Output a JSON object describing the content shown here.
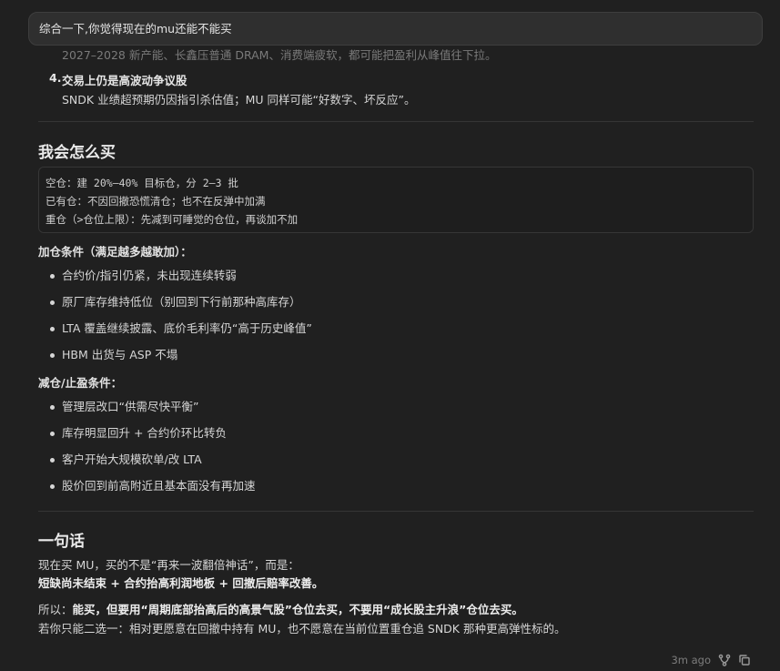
{
  "prompt": {
    "text": "综合一下,你觉得现在的mu还能不能买"
  },
  "faded_line": "2027–2028 新产能、长鑫压普通 DRAM、消费端疲软，都可能把盈利从峰值往下拉。",
  "item4": {
    "num": "4.",
    "heading": "交易上仍是高波动争议股",
    "body": "SNDK 业绩超预期仍因指引杀估值；MU 同样可能“好数字、坏反应”。"
  },
  "section_buy": {
    "title": "我会怎么买",
    "code_lines": [
      "空仓：建 20%–40% 目标仓，分 2–3 批",
      "已有仓：不因回撤恐慌清仓；也不在反弹中加满",
      "重仓（>仓位上限）：先减到可睡觉的仓位，再谈加不加"
    ],
    "add_label": "加仓条件（满足越多越敢加）：",
    "add_items": [
      "合约价/指引仍紧，未出现连续转弱",
      "原厂库存维持低位（别回到下行前那种高库存）",
      "LTA 覆盖继续披露、底价毛利率仍“高于历史峰值”",
      "HBM 出货与 ASP 不塌"
    ],
    "reduce_label": "减仓/止盈条件：",
    "reduce_items": [
      "管理层改口“供需尽快平衡”",
      "库存明显回升 + 合约价环比转负",
      "客户开始大规模砍单/改 LTA",
      "股价回到前高附近且基本面没有再加速"
    ]
  },
  "section_summary": {
    "title": "一句话",
    "line1": "现在买 MU，买的不是“再来一波翻倍神话”，而是：",
    "line2": "短缺尚未结束 + 合约抬高利润地板 + 回撤后赔率改善。",
    "line3_prefix": "所以：",
    "line3_bold": "能买，但要用“周期底部抬高后的高景气股”仓位去买，不要用“成长股主升浪”仓位去买。",
    "line4": "若你只能二选一：相对更愿意在回撤中持有 MU，也不愿意在当前位置重仓追 SNDK 那种更高弹性标的。"
  },
  "meta": {
    "time": "3m ago",
    "branch_icon": "branch-icon",
    "copy_icon": "copy-icon"
  }
}
